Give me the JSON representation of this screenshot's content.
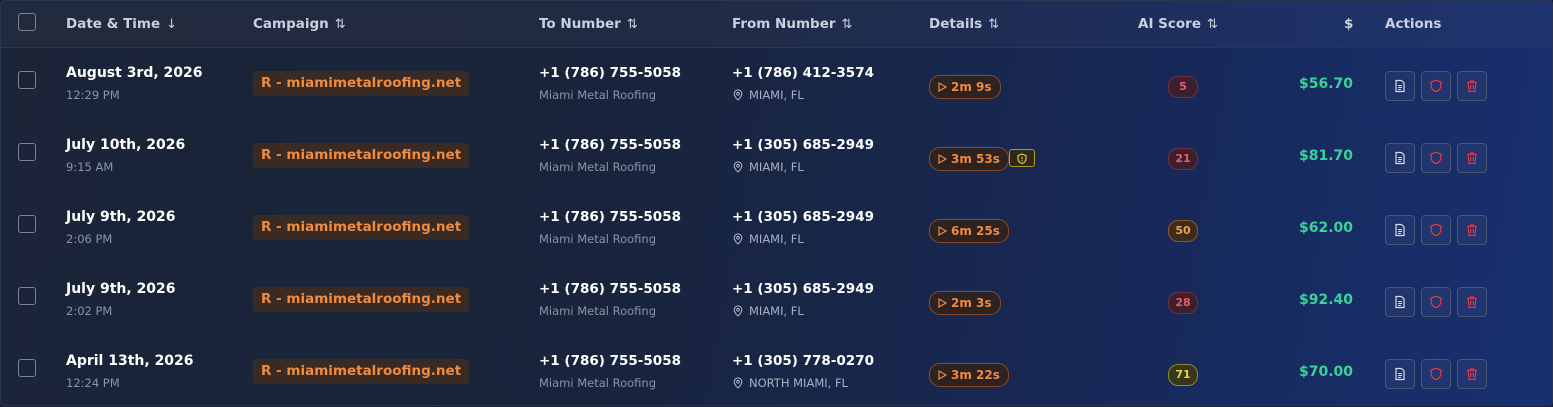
{
  "header": {
    "datetime": "Date & Time",
    "campaign": "Campaign",
    "to_number": "To Number",
    "from_number": "From Number",
    "details": "Details",
    "ai_score": "AI Score",
    "amount": "$",
    "actions": "Actions",
    "sort_desc_glyph": "↓",
    "sort_glyph": "⇅"
  },
  "rows": [
    {
      "date": "August 3rd, 2026",
      "time": "12:29 PM",
      "campaign": "R - miamimetalroofing.net",
      "to": "+1 (786) 755-5058",
      "to_name": "Miami Metal Roofing",
      "from": "+1 (786) 412-3574",
      "location": "MIAMI, FL",
      "duration": "2m 9s",
      "flag": false,
      "score": "5",
      "amount": "$56.70"
    },
    {
      "date": "July 10th, 2026",
      "time": "9:15 AM",
      "campaign": "R - miamimetalroofing.net",
      "to": "+1 (786) 755-5058",
      "to_name": "Miami Metal Roofing",
      "from": "+1 (305) 685-2949",
      "location": "MIAMI, FL",
      "duration": "3m 53s",
      "flag": true,
      "score": "21",
      "amount": "$81.70"
    },
    {
      "date": "July 9th, 2026",
      "time": "2:06 PM",
      "campaign": "R - miamimetalroofing.net",
      "to": "+1 (786) 755-5058",
      "to_name": "Miami Metal Roofing",
      "from": "+1 (305) 685-2949",
      "location": "MIAMI, FL",
      "duration": "6m 25s",
      "flag": false,
      "score": "50",
      "amount": "$62.00"
    },
    {
      "date": "July 9th, 2026",
      "time": "2:02 PM",
      "campaign": "R - miamimetalroofing.net",
      "to": "+1 (786) 755-5058",
      "to_name": "Miami Metal Roofing",
      "from": "+1 (305) 685-2949",
      "location": "MIAMI, FL",
      "duration": "2m 3s",
      "flag": false,
      "score": "28",
      "amount": "$92.40"
    },
    {
      "date": "April 13th, 2026",
      "time": "12:24 PM",
      "campaign": "R - miamimetalroofing.net",
      "to": "+1 (786) 755-5058",
      "to_name": "Miami Metal Roofing",
      "from": "+1 (305) 778-0270",
      "location": "NORTH MIAMI, FL",
      "duration": "3m 22s",
      "flag": false,
      "score": "71",
      "amount": "$70.00"
    }
  ],
  "score_colors": {
    "low": {
      "bg": "#3b1f2a",
      "border": "#7a2e3f",
      "text": "#ef5a6e"
    },
    "mid": {
      "bg": "#3d2c1e",
      "border": "#8a5a22",
      "text": "#f0a040"
    },
    "high": {
      "bg": "#35361c",
      "border": "#8c8a25",
      "text": "#e8d53a"
    }
  },
  "icons": {
    "details": "document-icon",
    "flag": "shield-icon",
    "delete": "trash-icon",
    "location": "map-pin-icon",
    "play": "play-icon"
  },
  "colors": {
    "accent_orange": "#f08a3c",
    "money_green": "#39d39a",
    "danger_red": "#e0384d"
  }
}
